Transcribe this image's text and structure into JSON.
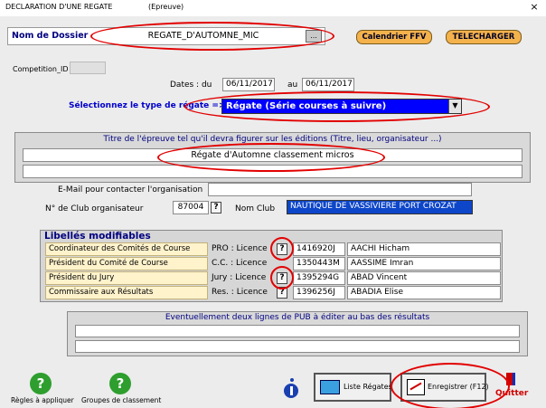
{
  "window": {
    "title": "DECLARATION D'UNE REGATE",
    "subtitle": "(Epreuve)",
    "close": "×"
  },
  "colors": {
    "accent_blue": "#0000ff",
    "annotation_red": "#e20000",
    "orange_button": "#f4b24c",
    "club_field": "#0d46c9"
  },
  "dossier": {
    "label": "Nom de Dossier",
    "value": "REGATE_D'AUTOMNE_MIC",
    "browse": "..."
  },
  "buttons": {
    "calendrier": "Calendrier FFV",
    "telecharger": "TELECHARGER"
  },
  "competition": {
    "label": "Competition_ID",
    "value": ""
  },
  "dates": {
    "label_du": "Dates : du",
    "from": "06/11/2017",
    "label_au": "au",
    "to": "06/11/2017"
  },
  "regate_type": {
    "label": "Sélectionnez le type de régate =>",
    "value": "Régate (Série courses à suivre)"
  },
  "titre": {
    "header": "Titre de l'épreuve tel qu'il devra figurer sur les éditions (Titre, lieu, organisateur ...)",
    "line1": "Régate d'Automne classement micros",
    "line2": ""
  },
  "email": {
    "label": "E-Mail pour contacter l'organisation",
    "value": ""
  },
  "club": {
    "num_label": "N° de Club organisateur",
    "num_value": "87004",
    "q": "?",
    "nom_label": "Nom Club",
    "nom_value": "NAUTIQUE DE VASSIVIERE PORT CROZAT"
  },
  "libelles": {
    "title": "Libellés modifiables",
    "rows": [
      {
        "label": "Coordinateur des Comités de Course",
        "role": "PRO : Licence",
        "q": "?",
        "licence": "1416920J",
        "name": "AACHI Hicham"
      },
      {
        "label": "Président du Comité de Course",
        "role": "C.C. : Licence",
        "q": "",
        "licence": "1350443M",
        "name": "AASSIME Imran"
      },
      {
        "label": "Président du Jury",
        "role": "Jury : Licence",
        "q": "?",
        "licence": "1395294G",
        "name": "ABAD Vincent"
      },
      {
        "label": "Commissaire aux Résultats",
        "role": "Res. : Licence",
        "q": "?",
        "licence": "1396256J",
        "name": "ABADIA Elise"
      }
    ]
  },
  "pub": {
    "header": "Eventuellement deux lignes de PUB à éditer au bas des résultats",
    "line1": "",
    "line2": ""
  },
  "footer": {
    "regles": "Règles à appliquer",
    "groupes": "Groupes de classement",
    "liste": "Liste Régates",
    "enregistrer": "Enregistrer (F12)",
    "quitter": "Quitter",
    "help_glyph": "?"
  }
}
